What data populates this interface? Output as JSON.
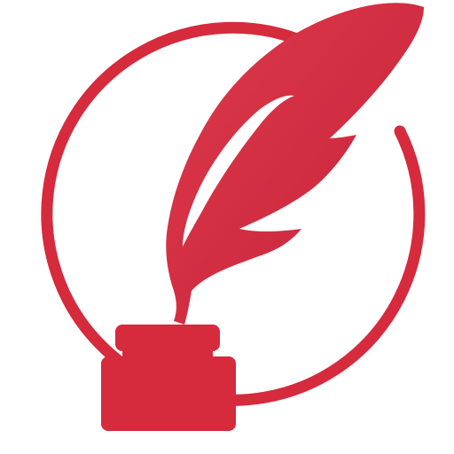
{
  "logo": {
    "icon": "quill-and-inkwell-icon",
    "colors": {
      "primary": "#D52B3D",
      "background": "#FFFFFF"
    }
  }
}
